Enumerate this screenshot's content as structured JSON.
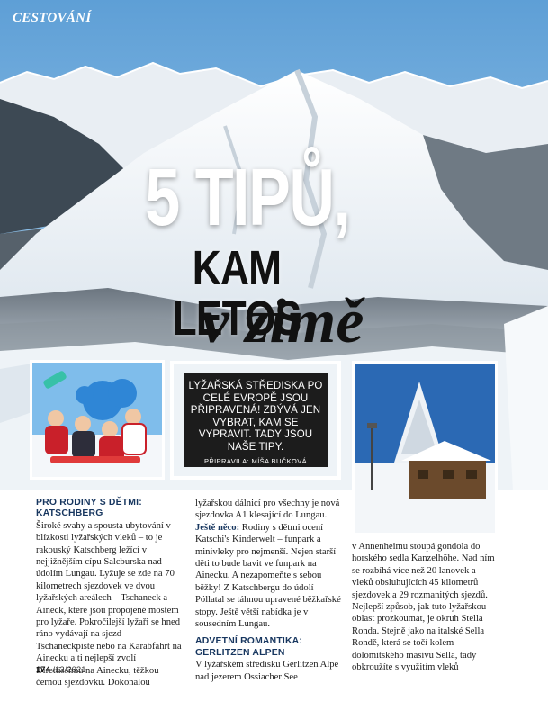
{
  "section": "CESTOVÁNÍ",
  "headline": {
    "line1": "5 TIPŮ,",
    "line2": "KAM LETOS",
    "line3": "v zimě"
  },
  "intro": {
    "text": "LYŽAŘSKÁ STŘEDISKA PO CELÉ EVROPĚ JSOU PŘIPRAVENÁ! ZBÝVÁ JEN VYBRAT, KAM SE VYPRAVIT. TADY JSOU NAŠE TIPY.",
    "credit": "PŘIPRAVILA: MÍŠA BUČKOVÁ"
  },
  "article": {
    "s1_heading1": "PRO RODINY S DĚTMI:",
    "s1_heading2": "KATSCHBERG",
    "s1_body": "Široké svahy a spousta ubytování v blízkosti lyžařských vleků – to je rakouský Katschberg ležící v nejjižnějším cípu Salcburska nad údolím Lungau. Lyžuje se zde na 70 kilometrech sjezdovek ve dvou lyžařských areálech – Tschaneck a Aineck, které jsou propojené mostem pro lyžaře. Pokročilejší lyžaři se hned ráno vydávají na sjezd Tschaneckpiste nebo na Karabfahrt na Ainecku a ti nejlepší zvolí Direttissimu na Ainecku, těžkou černou sjezdovku. Dokonalou",
    "s1_cont": "lyžařskou dálnicí pro všechny je nová sjezdovka A1 klesající do Lungau.",
    "tip_label": "Ještě něco:",
    "tip_body": " Rodiny s dětmi ocení Katschi's Kinderwelt – funpark a minivleky pro nejmenší. Nejen starší děti to bude bavit ve funpark na Ainecku. A nezapomeňte s sebou běžky! Z Katschbergu do údolí Pöllatal se táhnou upravené běžkařské stopy. Ještě větší nabídka je v sousedním Lungau.",
    "s2_heading1": "ADVETNÍ ROMANTIKA:",
    "s2_heading2": "GERLITZEN ALPEN",
    "s2_body": "V lyžařském středisku Gerlitzen Alpe nad jezerem Ossiacher See",
    "s2_cont": "v Annenheimu stoupá gondola do horského sedla Kanzelhöhe. Nad ním se rozbíhá více než 20 lanovek a vleků obsluhujících 45 kilometrů sjezdovek a 29 rozmanitých sjezdů. Nejlepší způsob, jak tuto lyžařskou oblast prozkoumat, je okruh Stella Ronda. Stejně jako na italské Sella Rondě, která se točí kolem dolomitského masivu Sella, tady obkroužíte s využitím vleků"
  },
  "footer": {
    "page": "174",
    "issue": "/12/2021"
  },
  "colors": {
    "accent_blue": "#17365f",
    "intro_bg": "#1c1c1c",
    "sky": "#8fc3ea"
  }
}
